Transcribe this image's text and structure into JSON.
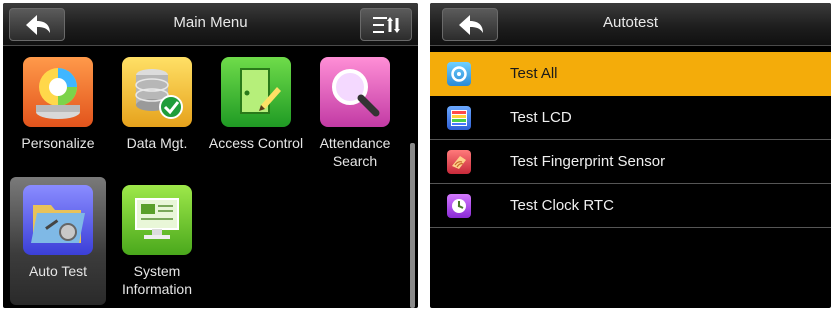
{
  "left": {
    "title": "Main Menu",
    "items": [
      {
        "label": "Personalize",
        "icon": "personalize-icon"
      },
      {
        "label": "Data Mgt.",
        "icon": "database-icon"
      },
      {
        "label": "Access Control",
        "icon": "door-icon"
      },
      {
        "label": "Attendance Search",
        "icon": "magnifier-icon"
      },
      {
        "label": "Auto Test",
        "icon": "folder-tools-icon"
      },
      {
        "label": "System Information",
        "icon": "monitor-icon"
      }
    ],
    "selected": "Auto Test"
  },
  "right": {
    "title": "Autotest",
    "items": [
      {
        "label": "Test All",
        "icon": "target-icon",
        "active": true
      },
      {
        "label": "Test LCD",
        "icon": "lcd-bars-icon"
      },
      {
        "label": "Test Fingerprint Sensor",
        "icon": "fingerprint-icon"
      },
      {
        "label": "Test Clock RTC",
        "icon": "clock-icon"
      }
    ]
  },
  "colors": {
    "highlight": "#f4ac0a",
    "background": "#000000",
    "title_bar": "#1e1e1e"
  }
}
